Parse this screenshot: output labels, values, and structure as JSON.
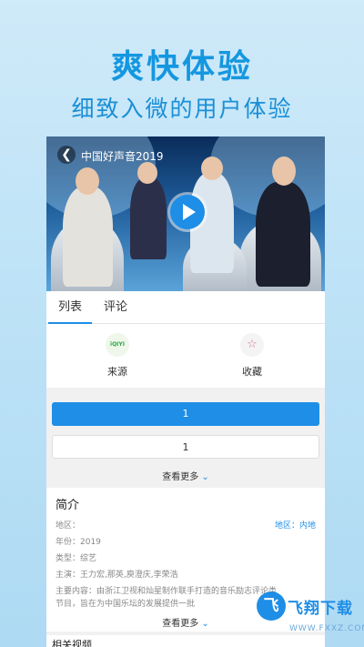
{
  "promo": {
    "title": "爽快体验",
    "subtitle": "细致入微的用户体验"
  },
  "video": {
    "title": "中国好声音2019",
    "back_glyph": "❮"
  },
  "tabs": [
    "列表",
    "评论"
  ],
  "actions": {
    "source_label": "来源",
    "source_icon_text": "iQIYI",
    "favorite_label": "收藏",
    "favorite_glyph": "☆"
  },
  "episodes": {
    "selected": "1",
    "second": "1",
    "see_more": "查看更多"
  },
  "intro": {
    "title": "简介",
    "region_label": "地区：",
    "region_value": "地区：内地",
    "year": "年份：2019",
    "type": "类型：综艺",
    "cast": "主演：王力宏,那英,庾澄庆,李荣浩",
    "content_1": "主要内容：由浙江卫视和灿星制作联手打造的音乐励志评论类",
    "content_2": "节目，旨在为中国乐坛的发展提供一批",
    "see_more": "查看更多"
  },
  "related": {
    "title": "相关视频"
  },
  "watermark": {
    "badge": "飞",
    "text": "飞翔下载",
    "url": "WWW.FXXZ.COM"
  },
  "colors": {
    "accent": "#1e8ee6",
    "promo_text": "#1597e0"
  }
}
